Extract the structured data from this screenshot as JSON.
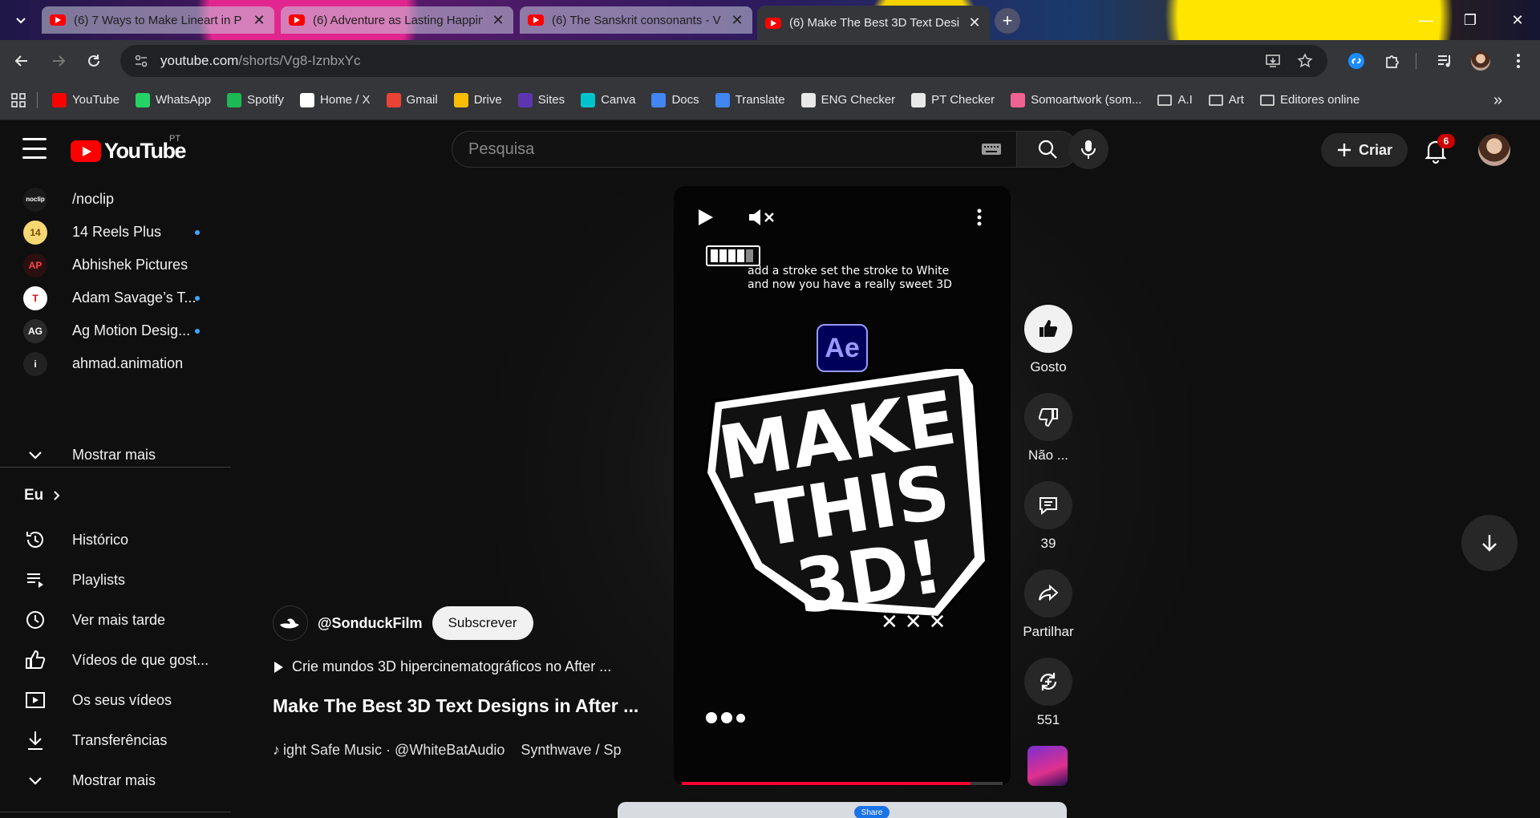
{
  "browser": {
    "tabs": [
      {
        "title": "(6) 7 Ways to Make Lineart in P"
      },
      {
        "title": "(6) Adventure as Lasting Happin"
      },
      {
        "title": "(6) The Sanskrit consonants - V"
      },
      {
        "title": "(6) Make The Best 3D Text Desig",
        "active": true
      }
    ],
    "url_host": "youtube.com",
    "url_path": "/shorts/Vg8-IznbxYc",
    "bookmarks": [
      {
        "label": "YouTube",
        "color": "#ff0000"
      },
      {
        "label": "WhatsApp",
        "color": "#25d366"
      },
      {
        "label": "Spotify",
        "color": "#1db954"
      },
      {
        "label": "Home / X",
        "color": "#ffffff"
      },
      {
        "label": "Gmail",
        "color": "#ea4335"
      },
      {
        "label": "Drive",
        "color": "#fbbc04"
      },
      {
        "label": "Sites",
        "color": "#5e35b1"
      },
      {
        "label": "Canva",
        "color": "#00c4cc"
      },
      {
        "label": "Docs",
        "color": "#4285f4"
      },
      {
        "label": "Translate",
        "color": "#4285f4"
      },
      {
        "label": "ENG Checker",
        "color": "#e8e8e8"
      },
      {
        "label": "PT Checker",
        "color": "#e8e8e8"
      },
      {
        "label": "Somoartwork (som...",
        "color": "#f06292"
      }
    ],
    "bookmark_folders": [
      "A.I",
      "Art",
      "Editores online"
    ]
  },
  "youtube": {
    "region": "PT",
    "logo_text": "YouTube",
    "search_placeholder": "Pesquisa",
    "create_label": "Criar",
    "notification_count": "6",
    "subscriptions": [
      {
        "label": "/noclip",
        "icon": "noclip-avatar",
        "new": false
      },
      {
        "label": "14 Reels Plus",
        "icon": "reels-avatar",
        "new": true
      },
      {
        "label": "Abhishek Pictures",
        "icon": "abhishek-avatar",
        "new": false
      },
      {
        "label": "Adam Savage’s T...",
        "icon": "tested-avatar",
        "new": true
      },
      {
        "label": "Ag Motion Desig...",
        "icon": "ag-avatar",
        "new": true
      },
      {
        "label": "ahmad.animation",
        "icon": "ahmad-avatar",
        "new": false
      }
    ],
    "show_more_1": "Mostrar mais",
    "you_section": "Eu",
    "you_items": [
      {
        "label": "Histórico",
        "icon": "history-icon"
      },
      {
        "label": "Playlists",
        "icon": "playlists-icon"
      },
      {
        "label": "Ver mais tarde",
        "icon": "watch-later-icon"
      },
      {
        "label": "Vídeos de que gost...",
        "icon": "liked-icon"
      },
      {
        "label": "Os seus vídeos",
        "icon": "your-videos-icon"
      },
      {
        "label": "Transferências",
        "icon": "downloads-icon"
      }
    ],
    "show_more_2": "Mostrar mais"
  },
  "short": {
    "caption": "add a stroke set the stroke to White and now you have a really sweet 3D",
    "ae_logo": "Ae",
    "big_text_lines": [
      "MAKE",
      "THIS",
      "3D!"
    ],
    "marks": "✕✕✕",
    "progress": 0.9,
    "channel": "@SonduckFilm",
    "subscribe": "Subscrever",
    "description": "Crie mundos 3D hipercinematográficos no After ...",
    "title": "Make The Best 3D Text Designs in After ...",
    "music": "ight Safe Music · @WhiteBatAudio    Synthwave / Sp",
    "actions": {
      "like": "Gosto",
      "dislike": "Não ...",
      "comments": "39",
      "share": "Partilhar",
      "remix": "551"
    }
  },
  "taskbar_peek": {
    "share": "Share"
  }
}
